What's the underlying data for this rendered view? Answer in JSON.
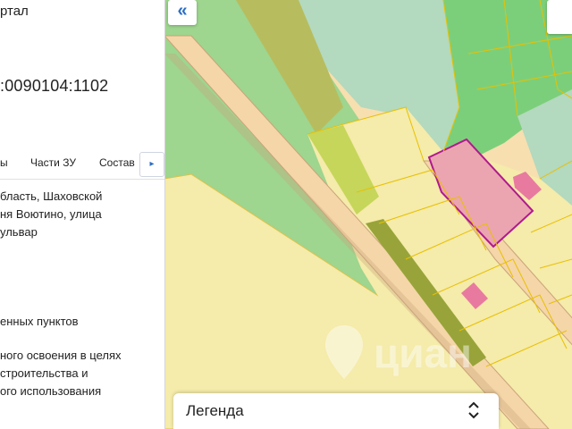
{
  "panel": {
    "title": "ртал",
    "cadastral_number": ":0090104:1102",
    "tabs": [
      "ы",
      "Части ЗУ",
      "Состав"
    ],
    "tab_next_icon": "chevron-right-icon",
    "address_lines": [
      "бласть, Шаховской",
      "ня Воютино, улица",
      "ульвар"
    ],
    "category": "енных пунктов",
    "permitted_use_lines": [
      "ного освоения в целях",
      "строительства и",
      "ого использования"
    ]
  },
  "map": {
    "collapse_icon": "double-chevron-left-icon",
    "watermark": "циан",
    "legend_label": "Легенда",
    "legend_icon": "chevrons-up-down-icon",
    "colors": {
      "land_beige": "#f7dfb0",
      "field_yellow": "#f5ebaa",
      "forest_green": "#9ed58f",
      "forest_dark": "#7ccf7a",
      "pale_teal": "#b3d9be",
      "road": "#f5d6a8",
      "road_edge": "#c9a37a",
      "olive": "#b7bd5e",
      "parcel_pink": "#eba5b0",
      "parcel_border": "#b0198f",
      "boundary_line": "#e8c000"
    }
  }
}
